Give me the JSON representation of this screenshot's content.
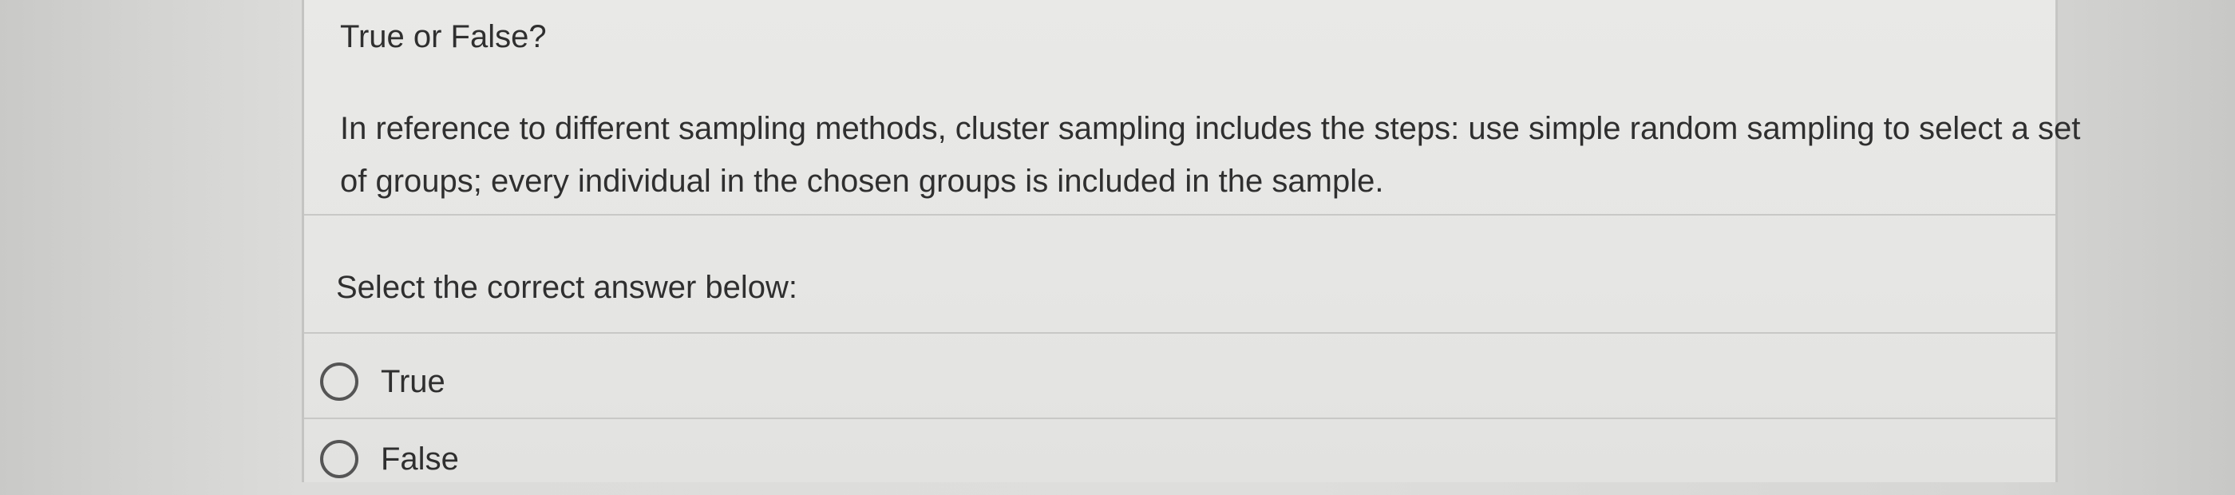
{
  "question": {
    "title": "True or False?",
    "body_line1": "In reference to different sampling methods, cluster sampling includes the steps: use simple random sampling to select a set",
    "body_line2": "of groups; every individual in the chosen groups is included in the sample."
  },
  "prompt": "Select the correct answer below:",
  "options": [
    {
      "label": "True"
    },
    {
      "label": "False"
    }
  ]
}
